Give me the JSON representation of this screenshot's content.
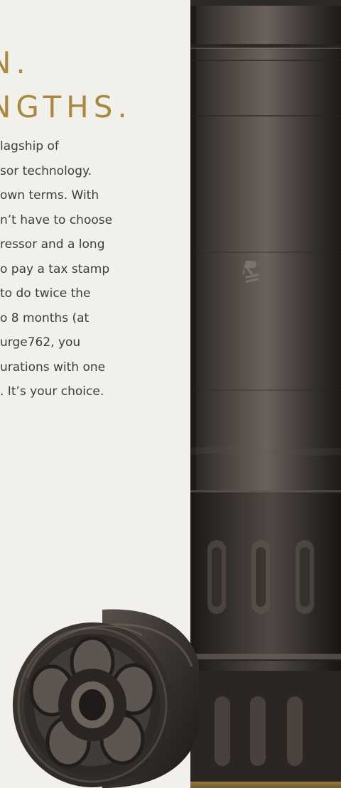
{
  "headline": {
    "line1": "N.",
    "line2": "NGTHS."
  },
  "body": {
    "lines": [
      "lagship of",
      "sor technology.",
      "own terms. With",
      "n’t have to choose",
      "ressor and a long",
      "o pay a tax stamp",
      "to do twice the",
      "o 8 months (at",
      "urge762, you",
      "urations with one",
      ". It’s your choice."
    ]
  },
  "product": {
    "logo_mark": "rugged-r-logo",
    "main_icon": "suppressor-tube-icon",
    "module_icon": "suppressor-module-icon"
  },
  "colors": {
    "background": "#f1f0eb",
    "accent": "#a9893f",
    "text": "#3d3d3d",
    "metal": "#3b3633"
  }
}
